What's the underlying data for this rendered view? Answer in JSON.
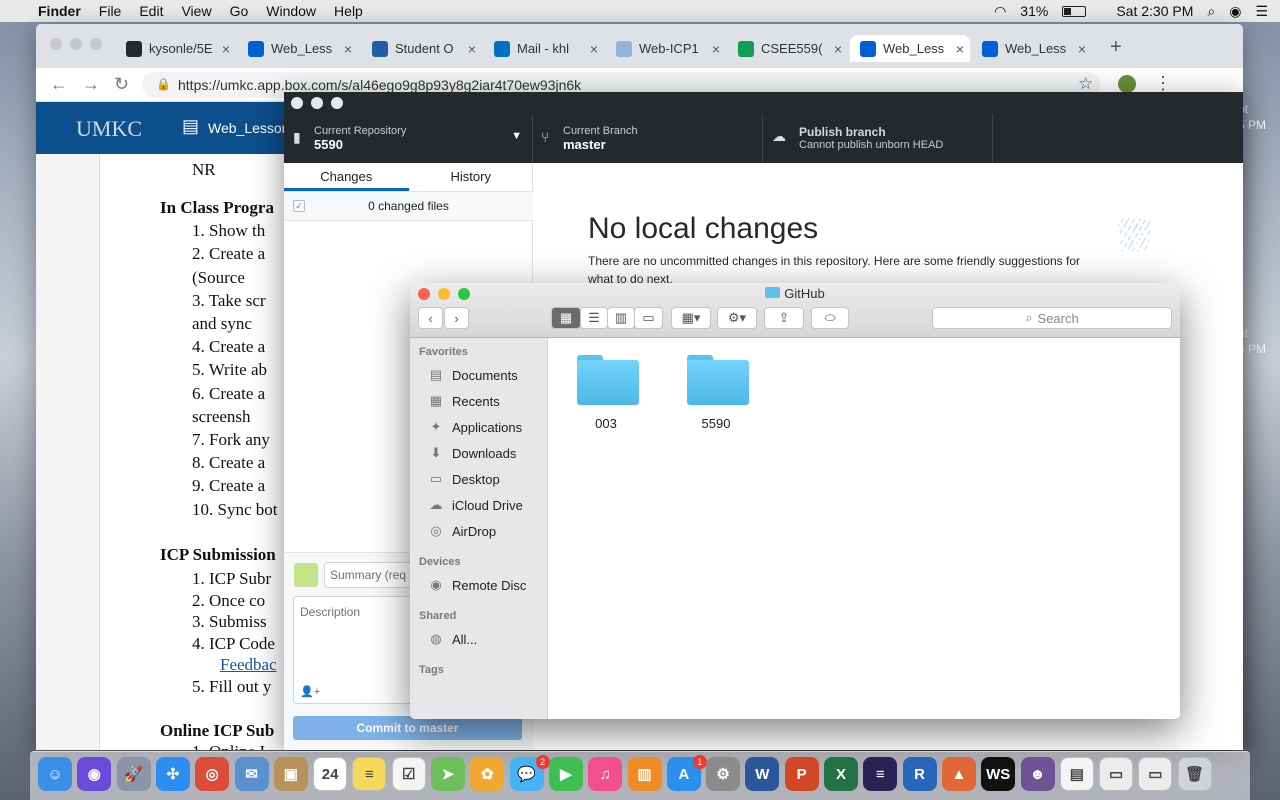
{
  "menubar": {
    "app": "Finder",
    "items": [
      "File",
      "Edit",
      "View",
      "Go",
      "Window",
      "Help"
    ],
    "battery": "31%",
    "clock": "Sat 2:30 PM"
  },
  "chrome": {
    "tabs": [
      {
        "label": "kysonle/5E",
        "color": "#24292e"
      },
      {
        "label": "Web_Less",
        "color": "#0061d5"
      },
      {
        "label": "Student O",
        "color": "#1f5fa6"
      },
      {
        "label": "Mail - khl",
        "color": "#0072c6"
      },
      {
        "label": "Web-ICP1",
        "color": "#8fb6d8"
      },
      {
        "label": "CSEE559(",
        "color": "#0f9d58"
      },
      {
        "label": "Web_Less",
        "color": "#0061d5"
      },
      {
        "label": "Web_Less",
        "color": "#0061d5"
      }
    ],
    "url": "https://umkc.app.box.com/s/al46ego9g8p93y8g2iar4t70ew93jn6k",
    "box_logo": "UMKC",
    "doc_title": "Web_Lesson",
    "doc_lines": [
      {
        "text": "NR",
        "b": false
      },
      {
        "text": "In Class Progra",
        "b": true
      },
      {
        "text": "1.   Show th",
        "b": false
      },
      {
        "text": "2.   Create a",
        "b": false
      },
      {
        "text": "       (Source",
        "b": false
      },
      {
        "text": "3.   Take scr",
        "b": false
      },
      {
        "text": "       and sync",
        "b": false
      },
      {
        "text": "4.   Create a",
        "b": false
      },
      {
        "text": "5.   Write ab",
        "b": false
      },
      {
        "text": "6.   Create a",
        "b": false
      },
      {
        "text": "       screensh",
        "b": false
      },
      {
        "text": "7.   Fork any",
        "b": false
      },
      {
        "text": "8.   Create a",
        "b": false
      },
      {
        "text": "9.   Create a",
        "b": false
      },
      {
        "text": "10. Sync bot",
        "b": false
      },
      {
        "text": "ICP Submission",
        "b": true
      },
      {
        "text": "1.   ICP Subr",
        "b": false
      },
      {
        "text": "2.   Once co",
        "b": false
      },
      {
        "text": "3.   Submiss",
        "b": false
      },
      {
        "text": "4.   ICP Code",
        "b": false
      },
      {
        "text": "Feedbac",
        "b": false,
        "link": true
      },
      {
        "text": "5.   Fill out y",
        "b": false
      },
      {
        "text": "Online ICP Sub",
        "b": true
      },
      {
        "text": "1.   Online I",
        "b": false
      }
    ]
  },
  "github": {
    "repo_label": "Current Repository",
    "repo": "5590",
    "branch_label": "Current Branch",
    "branch": "master",
    "publish_label": "Publish branch",
    "publish_sub": "Cannot publish unborn HEAD",
    "tab_changes": "Changes",
    "tab_history": "History",
    "changed_files": "0 changed files",
    "summary_placeholder": "Summary (req",
    "description_placeholder": "Description",
    "commit_label": "Commit to master",
    "heading": "No local changes",
    "subtext": "There are no uncommitted changes in this repository. Here are some friendly suggestions for what to do next."
  },
  "finder": {
    "title": "GitHub",
    "search_placeholder": "Search",
    "favorites_header": "Favorites",
    "favorites": [
      {
        "label": "Documents",
        "icon": "document-icon",
        "glyph": "▤"
      },
      {
        "label": "Recents",
        "icon": "recents-icon",
        "glyph": "▦"
      },
      {
        "label": "Applications",
        "icon": "applications-icon",
        "glyph": "✦"
      },
      {
        "label": "Downloads",
        "icon": "downloads-icon",
        "glyph": "⬇"
      },
      {
        "label": "Desktop",
        "icon": "desktop-icon",
        "glyph": "▭"
      },
      {
        "label": "iCloud Drive",
        "icon": "cloud-icon",
        "glyph": "☁"
      },
      {
        "label": "AirDrop",
        "icon": "airdrop-icon",
        "glyph": "◎"
      }
    ],
    "devices_header": "Devices",
    "devices": [
      {
        "label": "Remote Disc",
        "icon": "disc-icon",
        "glyph": "◉"
      }
    ],
    "shared_header": "Shared",
    "shared": [
      {
        "label": "All...",
        "icon": "network-icon",
        "glyph": "◍"
      }
    ],
    "tags_header": "Tags",
    "folders": [
      "003",
      "5590"
    ]
  },
  "dock": {
    "apps": [
      {
        "name": "finder",
        "color": "#3b8fe6",
        "glyph": "☺"
      },
      {
        "name": "siri",
        "color": "#6a4cd8",
        "glyph": "◉"
      },
      {
        "name": "launchpad",
        "color": "#8a96a8",
        "glyph": "🚀"
      },
      {
        "name": "safari",
        "color": "#2c8ef0",
        "glyph": "✣"
      },
      {
        "name": "chrome",
        "color": "#dd4b39",
        "glyph": "◎"
      },
      {
        "name": "mail",
        "color": "#5a8fd0",
        "glyph": "✉"
      },
      {
        "name": "contacts",
        "color": "#b8915b",
        "glyph": "▣"
      },
      {
        "name": "calendar",
        "color": "#ffffff",
        "glyph": "24"
      },
      {
        "name": "notes",
        "color": "#f6d85a",
        "glyph": "≡"
      },
      {
        "name": "reminders",
        "color": "#f4f4f4",
        "glyph": "☑"
      },
      {
        "name": "maps",
        "color": "#6cbf5a",
        "glyph": "➤"
      },
      {
        "name": "photos",
        "color": "#f0a830",
        "glyph": "✿"
      },
      {
        "name": "messages",
        "color": "#46b3f5",
        "glyph": "💬",
        "badge": "2"
      },
      {
        "name": "facetime",
        "color": "#3fbf52",
        "glyph": "▶"
      },
      {
        "name": "itunes",
        "color": "#f0508c",
        "glyph": "♫"
      },
      {
        "name": "ibooks",
        "color": "#f08a24",
        "glyph": "▥"
      },
      {
        "name": "appstore",
        "color": "#2b8ff0",
        "glyph": "A",
        "badge": "1"
      },
      {
        "name": "system-preferences",
        "color": "#8b8b8b",
        "glyph": "⚙"
      },
      {
        "name": "word",
        "color": "#2b579a",
        "glyph": "W"
      },
      {
        "name": "powerpoint",
        "color": "#d24726",
        "glyph": "P"
      },
      {
        "name": "excel",
        "color": "#217346",
        "glyph": "X"
      },
      {
        "name": "eclipse",
        "color": "#2c2255",
        "glyph": "≡"
      },
      {
        "name": "r",
        "color": "#2767b9",
        "glyph": "R"
      },
      {
        "name": "matlab",
        "color": "#e16737",
        "glyph": "▲"
      },
      {
        "name": "webstorm",
        "color": "#111111",
        "glyph": "WS"
      },
      {
        "name": "github-desktop",
        "color": "#6e5494",
        "glyph": "☻"
      },
      {
        "name": "document",
        "color": "#f4f4f4",
        "glyph": "▤"
      },
      {
        "name": "screenshot-1",
        "color": "#ececec",
        "glyph": "▭"
      },
      {
        "name": "screenshot-2",
        "color": "#ececec",
        "glyph": "▭"
      },
      {
        "name": "trash",
        "color": "#d0d4d8",
        "glyph": "🗑"
      }
    ]
  },
  "desktop": {
    "partial1": "ot",
    "partial2": "5 PM",
    "partial3": "ot",
    "partial4": "5 PM"
  }
}
